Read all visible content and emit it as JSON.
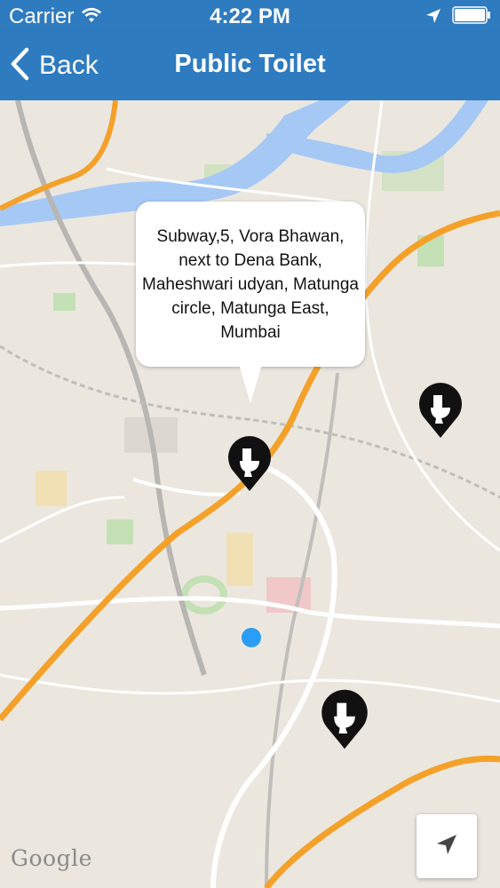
{
  "status_bar": {
    "carrier": "Carrier",
    "time": "4:22 PM",
    "wifi_icon": "wifi-icon",
    "location_icon": "location-arrow-icon",
    "battery_icon": "battery-icon"
  },
  "nav": {
    "back_label": "Back",
    "back_icon": "chevron-left-icon",
    "title": "Public Toilet"
  },
  "map": {
    "callout_text": "Subway,5, Vora Bhawan, next to Dena Bank, Maheshwari udyan, Matunga circle, Matunga East, Mumbai",
    "pin_icon": "toilet-icon",
    "attribution": "Google",
    "locate_icon": "location-arrow-icon",
    "colors": {
      "nav": "#2f7bc0",
      "map_base": "#ebe7df",
      "highway": "#f4a12a",
      "water": "#a6c8f5",
      "park": "#c4e0b5",
      "user_dot": "#2a9df4"
    }
  }
}
